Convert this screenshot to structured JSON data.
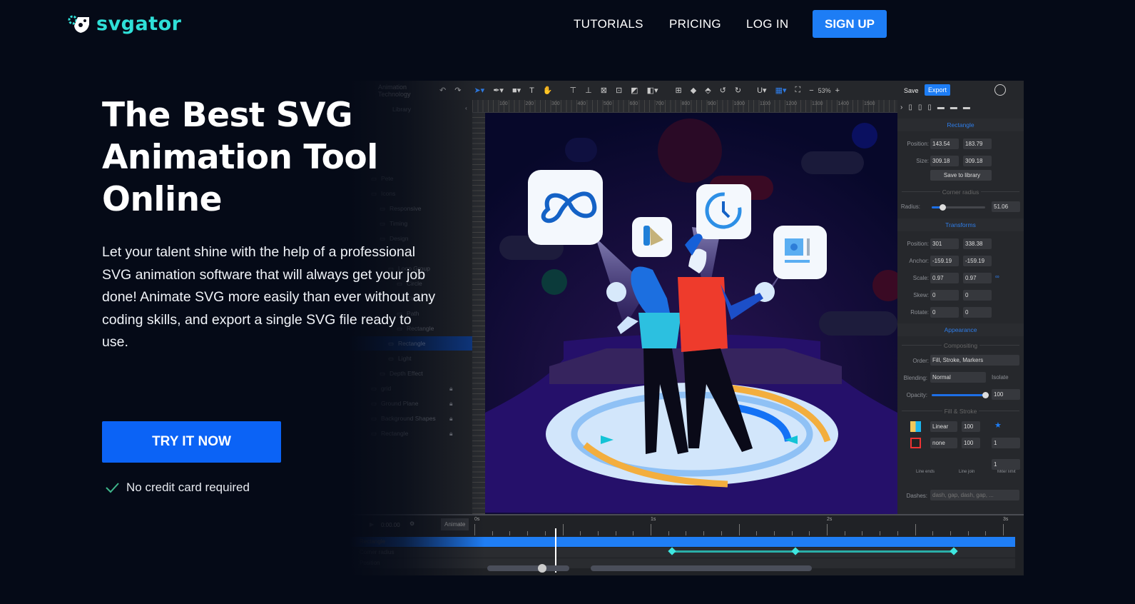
{
  "nav": {
    "logo": "svgator",
    "links": [
      "TUTORIALS",
      "PRICING",
      "LOG IN"
    ],
    "signup": "SIGN UP"
  },
  "hero": {
    "title": "The Best SVG Animation Tool Online",
    "description": "Let your talent shine with the help of a professional SVG animation software that will always get your job done! Animate SVG more easily than ever without any coding skills, and export a single SVG file ready to use.",
    "cta": "TRY IT NOW",
    "note": "No credit card required"
  },
  "app": {
    "project": "Animation Technology",
    "zoom": "53%",
    "save": "Save",
    "export": "Export",
    "library_tab": "Library",
    "ruler": [
      "100",
      "200",
      "300",
      "400",
      "500",
      "600",
      "700",
      "800",
      "900",
      "1000",
      "1100",
      "1200",
      "1300",
      "1400",
      "1500"
    ],
    "layers": [
      {
        "name": "Pete",
        "lock": false
      },
      {
        "name": "Icons",
        "lock": false
      },
      {
        "name": "Responsive",
        "lock": false
      },
      {
        "name": "Timing",
        "lock": false
      },
      {
        "name": "Design",
        "lock": false
      },
      {
        "name": "Loop",
        "lock": false
      },
      {
        "name": "Loop Group",
        "lock": false
      },
      {
        "name": "Circle",
        "lock": false
      },
      {
        "name": "Circle",
        "lock": false
      },
      {
        "name": "Path",
        "lock": false
      },
      {
        "name": "Rectangle",
        "lock": false
      },
      {
        "name": "Rectangle",
        "lock": false,
        "selected": true
      },
      {
        "name": "Light",
        "lock": false
      },
      {
        "name": "Depth Effect",
        "lock": false
      },
      {
        "name": "grid",
        "lock": true
      },
      {
        "name": "Ground Plane",
        "lock": true
      },
      {
        "name": "Background Shapes",
        "lock": true
      },
      {
        "name": "Rectangle",
        "lock": true
      }
    ],
    "props": {
      "rectangle": "Rectangle",
      "position_label": "Position:",
      "position": [
        "143.54",
        "183.79"
      ],
      "size_label": "Size:",
      "size": [
        "309.18",
        "309.18"
      ],
      "save_library": "Save to library",
      "corner_radius": "Corner radius",
      "radius_label": "Radius:",
      "radius": "51.06",
      "radius_level": 0.2,
      "transforms": "Transforms",
      "t_position": [
        "301",
        "338.38"
      ],
      "anchor_label": "Anchor:",
      "anchor": [
        "-159.19",
        "-159.19"
      ],
      "scale_label": "Scale:",
      "scale": [
        "0.97",
        "0.97"
      ],
      "skew_label": "Skew:",
      "skew": [
        "0",
        "0"
      ],
      "rotate_label": "Rotate:",
      "rotate": [
        "0",
        "0"
      ],
      "rotate_units": [
        "turn",
        "deg"
      ],
      "appearance": "Appearance",
      "compositing": "Compositing",
      "order_label": "Order:",
      "order": "Fill, Stroke, Markers",
      "blending_label": "Blending:",
      "blending": "Normal",
      "isolate": "Isolate",
      "opacity_label": "Opacity:",
      "opacity": "100",
      "opacity_level": 1,
      "fill_stroke": "Fill & Stroke",
      "fill_type": "Linear",
      "fill_opacity": "100",
      "stroke_type": "none",
      "stroke_opacity": "100",
      "stroke_width": "1",
      "line_ends": "Line ends",
      "line_join": "Line join",
      "miter_limit": "Miter limit",
      "miter": "1",
      "dashes_label": "Dashes:",
      "dashes_placeholder": "dash, gap, dash, gap, ..."
    },
    "timeline": {
      "time": "0:00.00",
      "animate": "Animate",
      "marks": [
        "0s",
        "1s",
        "2s",
        "3s"
      ],
      "rows": [
        "Rectangle",
        "Corner radius",
        "Position"
      ],
      "playhead_s": 0.46,
      "keyframes_s": [
        1.12,
        1.82,
        2.72
      ]
    }
  },
  "colors": {
    "accent": "#1d7df5",
    "cta": "#0b63f6",
    "logo": "#2fe0d8",
    "background": "#050a17",
    "keyframe": "#3ee6e0"
  }
}
